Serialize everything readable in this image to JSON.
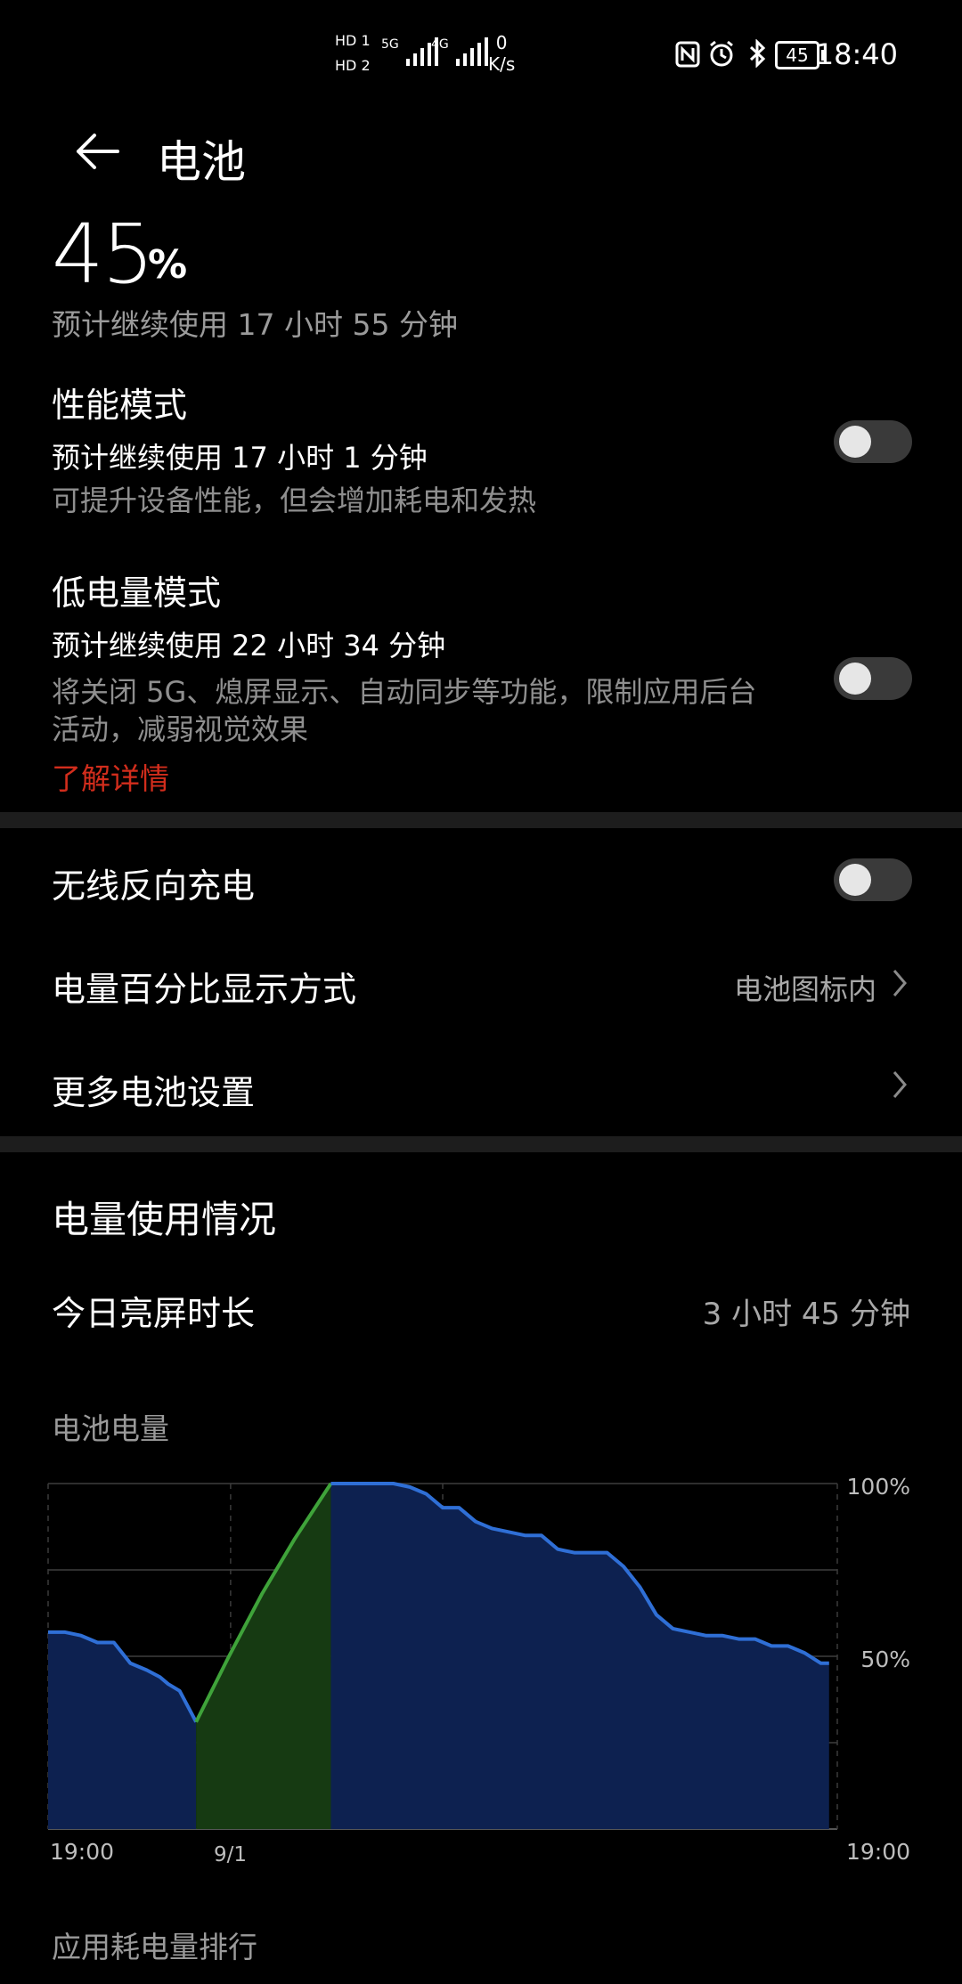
{
  "status": {
    "sim1": "HD 1",
    "sim2": "HD 2",
    "net1": "5G",
    "net2": "4G",
    "speed_value": "0",
    "speed_unit": "K/s",
    "battery": "45",
    "time": "18:40"
  },
  "header": {
    "title": "电池"
  },
  "battery": {
    "percent": "45",
    "unit": "%",
    "estimate": "预计继续使用 17 小时 55 分钟"
  },
  "performance_mode": {
    "title": "性能模式",
    "estimate": "预计继续使用 17 小时 1 分钟",
    "desc": "可提升设备性能，但会增加耗电和发热",
    "enabled": false
  },
  "low_power_mode": {
    "title": "低电量模式",
    "estimate": "预计继续使用 22 小时 34 分钟",
    "desc_line1": "将关闭 5G、熄屏显示、自动同步等功能，限制应用后台",
    "desc_line2": "活动，减弱视觉效果",
    "link": "了解详情",
    "enabled": false
  },
  "settings": {
    "wireless_reverse": {
      "label": "无线反向充电",
      "enabled": false
    },
    "percent_display": {
      "label": "电量百分比显示方式",
      "value": "电池图标内"
    },
    "more_settings": {
      "label": "更多电池设置"
    }
  },
  "usage": {
    "title": "电量使用情况",
    "screen_time_label": "今日亮屏时长",
    "screen_time_value": "3 小时 45 分钟",
    "chart_title": "电池电量",
    "ranking_title": "应用耗电量排行"
  },
  "colors": {
    "accent_red": "#d22d1c",
    "discharge_line": "#2f6fd6",
    "discharge_fill": "#0d2150",
    "charge_line": "#3fa33a",
    "charge_fill": "#163a12"
  },
  "chart_data": {
    "type": "area",
    "title": "电池电量",
    "x_tick_labels": [
      "19:00",
      "9/1",
      "19:00"
    ],
    "y_tick_labels": [
      "100%",
      "50%"
    ],
    "ylim": [
      0,
      100
    ],
    "grid": true,
    "x_hours": [
      0,
      1,
      2,
      3,
      4,
      5,
      6,
      6.8,
      7.3,
      8,
      9,
      11,
      11.5,
      12,
      13,
      13.3,
      14,
      14.5,
      15,
      16,
      17,
      18,
      18.5,
      19,
      20,
      21,
      22,
      23,
      24,
      25,
      26,
      27,
      28,
      29,
      29.5,
      30,
      31,
      31.5,
      32,
      33,
      34,
      34.5,
      35,
      36,
      36.5,
      37,
      38,
      39,
      40,
      41,
      42,
      43,
      43.5,
      44,
      45,
      46,
      47,
      47.5
    ],
    "series": [
      {
        "state": "discharging",
        "x": [
          0,
          1,
          2,
          3,
          4,
          5,
          6,
          6.8,
          7.3,
          8,
          9
        ],
        "values": [
          57,
          57,
          56,
          54,
          54,
          48,
          46,
          44,
          42,
          40,
          31
        ]
      },
      {
        "state": "charging",
        "x": [
          9,
          11,
          13,
          15,
          17.2
        ],
        "values": [
          31,
          50,
          68,
          84,
          100
        ]
      },
      {
        "state": "discharging",
        "x": [
          17.2,
          18,
          19,
          20,
          21,
          22,
          23,
          24,
          25,
          26,
          27,
          28,
          29,
          30,
          31,
          32,
          33,
          34,
          35,
          36,
          37,
          38,
          39,
          40,
          41,
          42,
          43,
          44,
          45,
          46,
          47,
          47.5
        ],
        "values": [
          100,
          100,
          100,
          100,
          100,
          99,
          97,
          93,
          93,
          89,
          87,
          86,
          85,
          85,
          81,
          80,
          80,
          80,
          76,
          70,
          62,
          58,
          57,
          56,
          56,
          55,
          55,
          53,
          53,
          51,
          48,
          48
        ]
      }
    ]
  }
}
